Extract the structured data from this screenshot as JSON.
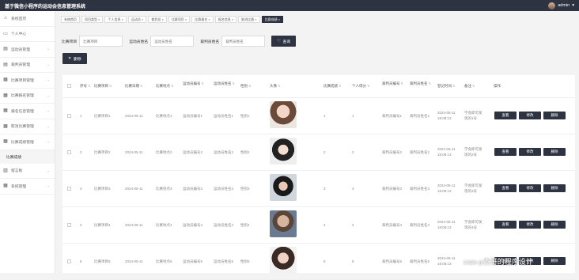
{
  "header": {
    "title": "基于微信小程序的运动会信息管理系统",
    "username": "admin",
    "caret": "▾"
  },
  "sidebar": {
    "items": [
      {
        "label": "系统首页",
        "icon": "home-icon"
      },
      {
        "label": "个人中心",
        "icon": "user-icon"
      },
      {
        "label": "运动员管理",
        "icon": "list-icon"
      },
      {
        "label": "裁判员管理",
        "icon": "list-icon"
      },
      {
        "label": "比赛项目管理",
        "icon": "grid-icon"
      },
      {
        "label": "比赛报名管理",
        "icon": "grid-icon"
      },
      {
        "label": "报名信息管理",
        "icon": "grid-icon"
      },
      {
        "label": "取消比赛管理",
        "icon": "grid-icon"
      },
      {
        "label": "比赛成绩管理",
        "icon": "grid-icon"
      }
    ],
    "sub_item": "比赛成绩",
    "bottom_items": [
      {
        "label": "留言板",
        "icon": "chart-icon"
      },
      {
        "label": "系统管理",
        "icon": "grid-icon"
      }
    ]
  },
  "tabs": [
    "系统首页",
    "项目类型 ×",
    "个人信息 ×",
    "运动员 ×",
    "裁判员 ×",
    "比赛项目 ×",
    "比赛报名 ×",
    "报名信息 ×",
    "取消比赛 ×",
    "比赛成绩 ×"
  ],
  "search": {
    "field1_label": "比赛项目",
    "field1_placeholder": "比赛项目",
    "field2_label": "运动员姓名",
    "field2_placeholder": "运动员姓名",
    "field3_label": "裁判员姓名",
    "field3_placeholder": "裁判员姓名",
    "button_label": "查询"
  },
  "toolbar": {
    "delete_label": "删除"
  },
  "table": {
    "columns": [
      "序号",
      "比赛项目",
      "比赛日期",
      "比赛地点",
      "运动员编号",
      "运动员姓名",
      "性别",
      "头像",
      "比赛成绩",
      "个人得分",
      "裁判员编号",
      "裁判员姓名",
      "登记时间",
      "备注",
      "操作"
    ],
    "rows": [
      {
        "no": "1",
        "project": "比赛项目1",
        "date": "2024-05-11",
        "place": "比赛地点1",
        "ath_no": "运动员编号1",
        "ath_name": "运动员姓名1",
        "gender": "性别1",
        "score": "1",
        "points": "1",
        "ref_no": "裁判员编号1",
        "ref_name": "裁判员姓名1",
        "time1": "2024-05-11",
        "time2": "18:08:13",
        "note1": "学会即可发",
        "note2": "现的1号"
      },
      {
        "no": "2",
        "project": "比赛项目2",
        "date": "2024-05-11",
        "place": "比赛地点2",
        "ath_no": "运动员编号2",
        "ath_name": "运动员姓名2",
        "gender": "性别2",
        "score": "2",
        "points": "2",
        "ref_no": "裁判员编号2",
        "ref_name": "裁判员姓名2",
        "time1": "2024-05-11",
        "time2": "18:08:13",
        "note1": "学会即可发",
        "note2": "现的2号"
      },
      {
        "no": "3",
        "project": "比赛项目3",
        "date": "2024-05-11",
        "place": "比赛地点3",
        "ath_no": "运动员编号3",
        "ath_name": "运动员姓名3",
        "gender": "性别3",
        "score": "3",
        "points": "3",
        "ref_no": "裁判员编号3",
        "ref_name": "裁判员姓名3",
        "time1": "2024-05-11",
        "time2": "18:08:13",
        "note1": "学会即可发",
        "note2": "现的3号"
      },
      {
        "no": "4",
        "project": "比赛项目4",
        "date": "2024-05-11",
        "place": "比赛地点4",
        "ath_no": "运动员编号4",
        "ath_name": "运动员姓名4",
        "gender": "性别4",
        "score": "4",
        "points": "4",
        "ref_no": "裁判员编号4",
        "ref_name": "裁判员姓名4",
        "time1": "2024-05-11",
        "time2": "18:08:13",
        "note1": "学会即可发",
        "note2": "现的4号"
      },
      {
        "no": "5",
        "project": "比赛项目5",
        "date": "2024-05-11",
        "place": "比赛地点5",
        "ath_no": "运动员编号5",
        "ath_name": "运动员姓名5",
        "gender": "性别5",
        "score": "5",
        "points": "5",
        "ref_no": "裁判员编号5",
        "ref_name": "裁判员姓名5",
        "time1": "2024-05-11",
        "time2": "18:08:13",
        "note1": "",
        "note2": ""
      }
    ],
    "actions": [
      "查看",
      "修改",
      "删除"
    ]
  },
  "watermark": {
    "prefix": "CSDN @",
    "text": "杰哥的程序设计"
  },
  "colors": {
    "primary": "#2d3340",
    "background": "#f3f3f4"
  }
}
